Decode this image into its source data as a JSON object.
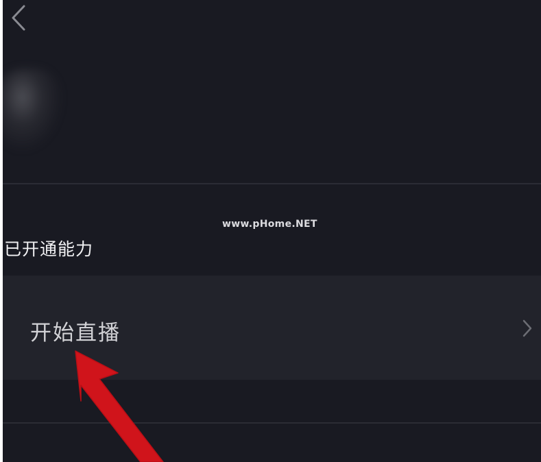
{
  "header": {
    "back_icon": "chevron-left-icon"
  },
  "profile": {
    "avatar_state": "blurred"
  },
  "abilities_section": {
    "title": "已开通能力",
    "items": [
      {
        "label": "开始直播",
        "icon": "chevron-right-icon"
      }
    ]
  },
  "watermark": {
    "text": "www.pHome.NET"
  },
  "annotation": {
    "type": "red-arrow",
    "color": "#d0141b",
    "points_to": "开始直播"
  },
  "colors": {
    "background": "#191a22",
    "row_background": "#22232b",
    "divider": "#2b2c35",
    "text_primary": "#f1f1f3",
    "text_secondary": "#d2d2d6"
  }
}
